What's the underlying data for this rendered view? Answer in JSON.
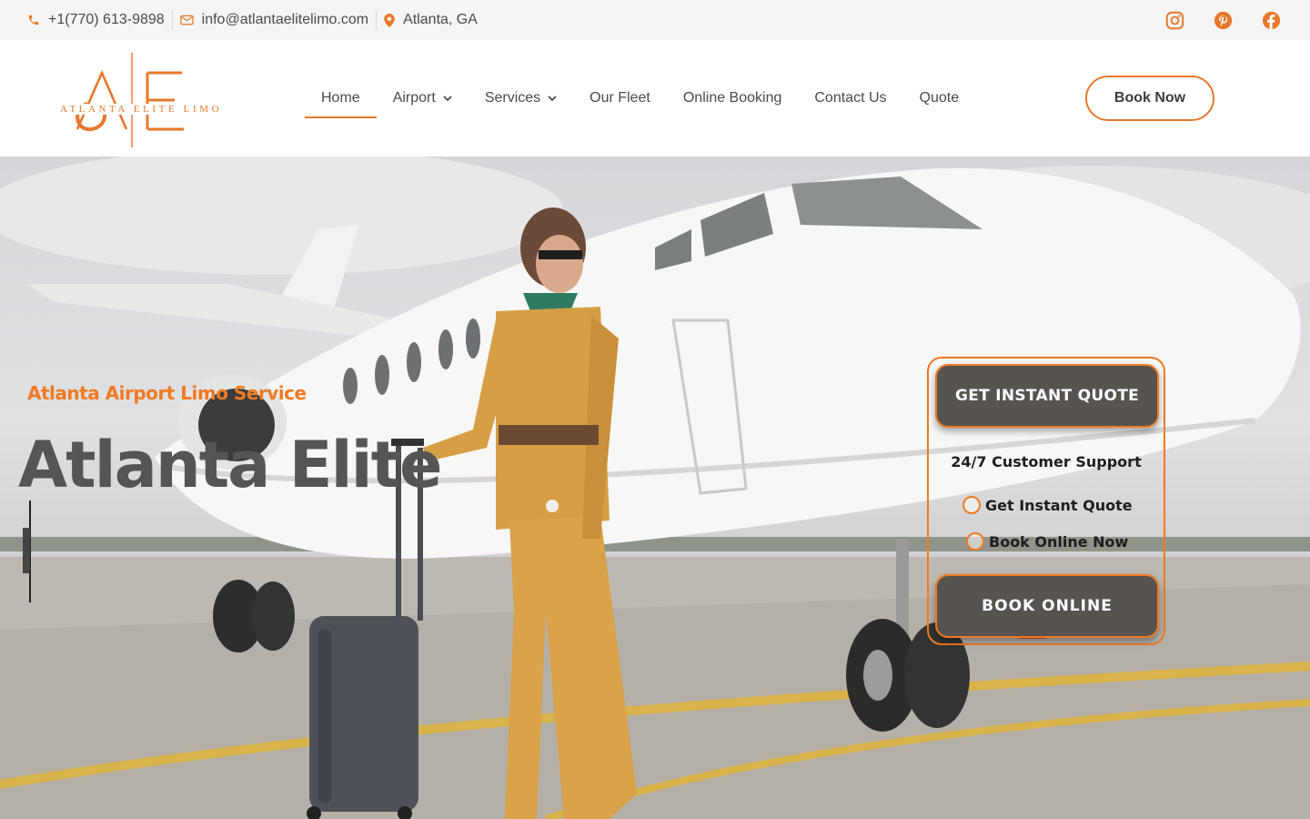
{
  "topbar": {
    "phone": "+1(770) 613-9898",
    "email": "info@atlantaelitelimo.com",
    "location": "Atlanta, GA",
    "social_icons": [
      "instagram-icon",
      "pinterest-icon",
      "facebook-icon"
    ]
  },
  "header": {
    "logo_monogram": "AE",
    "logo_text": "ATLANTA ELITE LIMO",
    "nav": [
      {
        "label": "Home",
        "active": true
      },
      {
        "label": "Airport",
        "dropdown": true
      },
      {
        "label": "Services",
        "dropdown": true
      },
      {
        "label": "Our Fleet"
      },
      {
        "label": "Online Booking"
      },
      {
        "label": "Contact Us"
      },
      {
        "label": "Quote"
      }
    ],
    "cta": "Book Now"
  },
  "hero": {
    "kicker": "Atlanta Airport Limo Service",
    "headline": "Atlanta Elite"
  },
  "card": {
    "quote_button": "GET INSTANT QUOTE",
    "support": "24/7 Customer Support",
    "options": [
      "Get Instant Quote",
      "Book Online Now"
    ],
    "book_button": "BOOK ONLINE"
  },
  "colors": {
    "accent": "#f07a22",
    "text": "#4a4a4a",
    "button_dark": "#57534f",
    "topbar_bg": "#f5f5f5"
  }
}
